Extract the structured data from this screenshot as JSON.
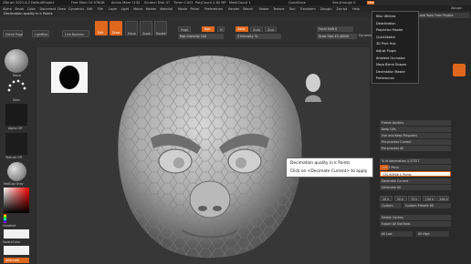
{
  "title_bar": {
    "app": "ZBrush 2021.6.2",
    "doc": "DefaultProject",
    "free_mem": "Free Mem 10.976GB",
    "active_mem": "Active Mem 1132",
    "scratch": "Scratch Disk 47",
    "timer": "Timer 0.001",
    "polycount": "PolyCount 2.62 MP",
    "meshcount": "MeshCount 1",
    "quicksave": "QuickSave",
    "see_through": "See-through 0",
    "menus": "Menus",
    "default_script": "DefaultZScript"
  },
  "subtitle": "Decimation quality in k Points",
  "menus": [
    "Alpha",
    "Brush",
    "Color",
    "Document",
    "Draw",
    "Dynamics",
    "Edit",
    "File",
    "Layer",
    "Light",
    "Macro",
    "Marker",
    "Material",
    "Movie",
    "Picker",
    "Preferences",
    "Render",
    "Stencil",
    "Stroke",
    "Texture",
    "Tool",
    "Transform",
    "Zplugin",
    "Zscript",
    "Help"
  ],
  "toolbar": {
    "home_page": "Home Page",
    "lightbox": "LightBox",
    "live_boolean": "Live Boolean",
    "edit": "Edit",
    "draw": "Draw",
    "move": "Move",
    "scale": "Scale",
    "rotate": "Rotate",
    "mrgb": "Mrgb",
    "rgb": "Rgb",
    "m": "M",
    "zadd": "Zadd",
    "zsub": "Zsub",
    "zcut": "Zcut",
    "rgb_intensity": "Rgb Intensity 100",
    "z_intensity": "Z Intensity 51",
    "focal_shift": "Focal Shift 0",
    "draw_size": "Draw Size 43.40558",
    "dynamic": "Dynamic"
  },
  "left_shelf": {
    "brush_label": "Move",
    "dots_label": "Dots",
    "alpha_label": "Alpha Off",
    "texture_label": "Texture Off",
    "matcap_label": "MatCap Gray",
    "gradient_label": "Gradient",
    "switch_color_label": "SwitchColor",
    "alternate_label": "Alternate"
  },
  "popup_menu": {
    "items": [
      "Misc Utilities",
      "Deactivation",
      "Projection Master",
      "QuickSketch",
      "3D Print Hub",
      "Adjust Plugin",
      "Ambient Occlusion",
      "Maya Blend Shapes",
      "Decimation Master",
      "Preferences"
    ]
  },
  "right_panel": {
    "header": "Zplugin",
    "load_plugin": "Load Tools From Project",
    "freeze_borders": "Freeze borders",
    "keep_uvs": "Keep UVs",
    "use_keep_polypaint": "Use and Keep Polypaint",
    "preprocess_current": "Pre-process Current",
    "preprocess_all": "Pre-process All",
    "pct_decimation": "% of decimation 4.37327",
    "k_polys": "120.5 Polys",
    "k_points": "120.60906 k Points",
    "decimate_current": "Decimate Current",
    "decimate_all": "Decimate All",
    "presets": [
      "20 k",
      "35 k",
      "75 k",
      "150 k",
      "200 k"
    ],
    "custom": "Custom",
    "custom_preset": "Custom Presets 80",
    "delete_caches": "Delete Caches",
    "export_all": "Export All SubTools",
    "all_low": "All Low",
    "all_high": "All High"
  },
  "tooltip": {
    "line1": "Decimation quality in k Points",
    "line2": "Click on <Decimate Current> to apply"
  },
  "colors": {
    "accent": "#e0671c",
    "panel": "#2a2a2a",
    "canvas": "#373737"
  }
}
